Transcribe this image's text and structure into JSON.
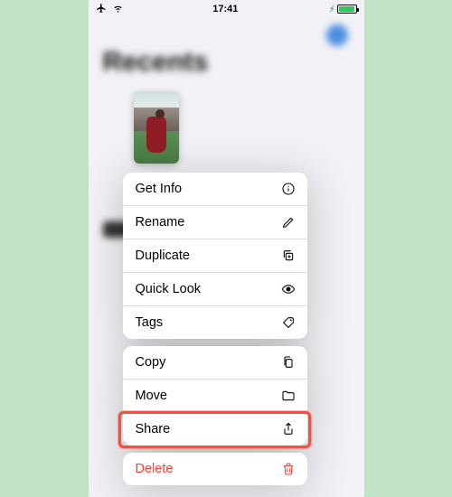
{
  "status": {
    "time": "17:41"
  },
  "backgroundTitle": "Recents",
  "menu": {
    "group1": [
      {
        "label": "Get Info"
      },
      {
        "label": "Rename"
      },
      {
        "label": "Duplicate"
      },
      {
        "label": "Quick Look"
      },
      {
        "label": "Tags"
      }
    ],
    "group2": [
      {
        "label": "Copy"
      },
      {
        "label": "Move"
      },
      {
        "label": "Share"
      }
    ],
    "group3": [
      {
        "label": "Delete"
      }
    ]
  }
}
